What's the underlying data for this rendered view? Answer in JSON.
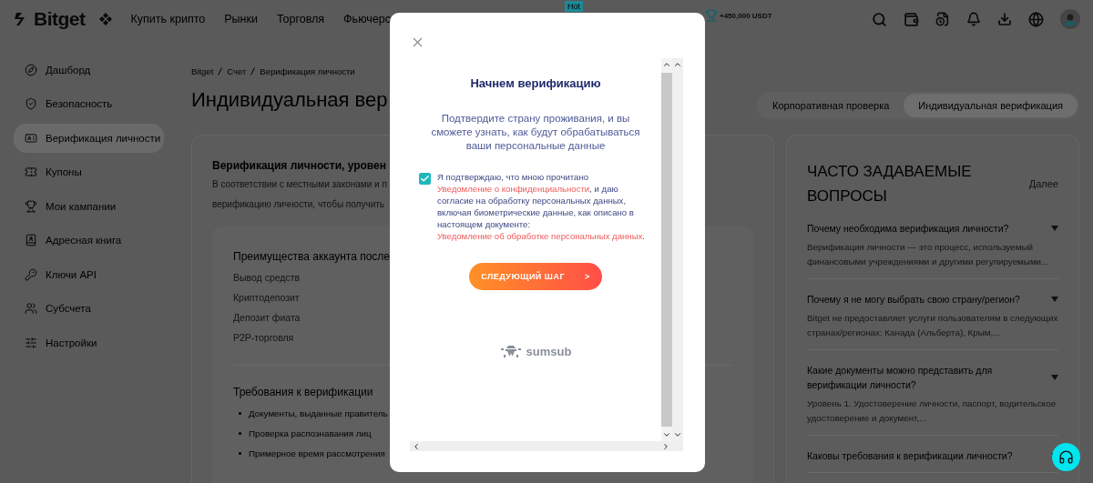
{
  "header": {
    "logo": "Bitget",
    "nav": [
      {
        "label": "Купить крипто"
      },
      {
        "label": "Рынки"
      },
      {
        "label": "Торговля"
      },
      {
        "label": "Фьючерс"
      }
    ],
    "hot_badge": "Hot",
    "reward": "+450,000 USDT"
  },
  "sidebar": {
    "items": [
      {
        "label": "Дашборд",
        "selected": false
      },
      {
        "label": "Безопасность",
        "selected": false
      },
      {
        "label": "Верификация личности",
        "selected": true
      },
      {
        "label": "Купоны",
        "selected": false
      },
      {
        "label": "Мои кампании",
        "selected": false
      },
      {
        "label": "Адресная книга",
        "selected": false
      },
      {
        "label": "Ключи API",
        "selected": false
      },
      {
        "label": "Субсчета",
        "selected": false
      },
      {
        "label": "Настройки",
        "selected": false
      }
    ]
  },
  "breadcrumb": [
    "Bitget",
    "Счет",
    "Верификация личности"
  ],
  "page_title": "Индивидуальная вер",
  "tabs": [
    {
      "label": "Корпоративная проверка",
      "selected": false
    },
    {
      "label": "Индивидуальная верификация",
      "selected": true
    }
  ],
  "verification_card": {
    "title": "Верификация личности, уровен",
    "description": [
      "В соответствии с местными законами и п",
      "верификацию личности, чтобы получить"
    ],
    "benefits_title": "Преимущества аккаунта после",
    "benefits": [
      "Вывод средств",
      "Криптодепозит",
      "Депозит фиата",
      "P2P-торговля"
    ],
    "requirements_title": "Требования к верификации",
    "requirements": [
      "Документы, выданные правитель",
      "Проверка распознавания лиц",
      "Примерное время рассмотрения"
    ]
  },
  "faq": {
    "title": "ЧАСТО ЗАДАВАЕМЫЕ ВОПРОСЫ",
    "more": "Далее",
    "items": [
      {
        "question": "Почему необходима верификация личности?",
        "answer": "Верификация личности — это процесс, используемый финансовыми учреждениями и другими регулируемыми..."
      },
      {
        "question": "Почему я не могу выбрать свою страну/регион?",
        "answer": "Bitget не предоставляет услуги пользователям в следующих странах/регионах: Канада (Альберта), Крым,..."
      },
      {
        "question": "Какие документы можно представить для верификации личности?",
        "answer": "Уровень 1. Удостоверение личности, паспорт, водительское удостоверение и документ,..."
      },
      {
        "question": "Каковы требования к верификации личности?"
      }
    ]
  },
  "modal": {
    "title": "Начнем верификацию",
    "subtitle": "Подтвердите страну проживания, и вы сможете узнать, как будут обрабатываться ваши персональные данные",
    "consent": {
      "checked": true,
      "parts": [
        {
          "kind": "text",
          "text": "Я подтверждаю, что мною прочитано"
        },
        {
          "kind": "link",
          "text": "Уведомление о конфиденциальности"
        },
        {
          "kind": "text",
          "text": ", и даю согласие на обработку персональных данных, включая биометрические данные, как описано в настоящем документе:"
        },
        {
          "kind": "link",
          "text": "Уведомление об обработке персональных данных"
        },
        {
          "kind": "text",
          "text": "."
        }
      ]
    },
    "button": "СЛЕДУЮЩИЙ ШАГ",
    "button_arrow": ">",
    "brand": "sumsub"
  }
}
